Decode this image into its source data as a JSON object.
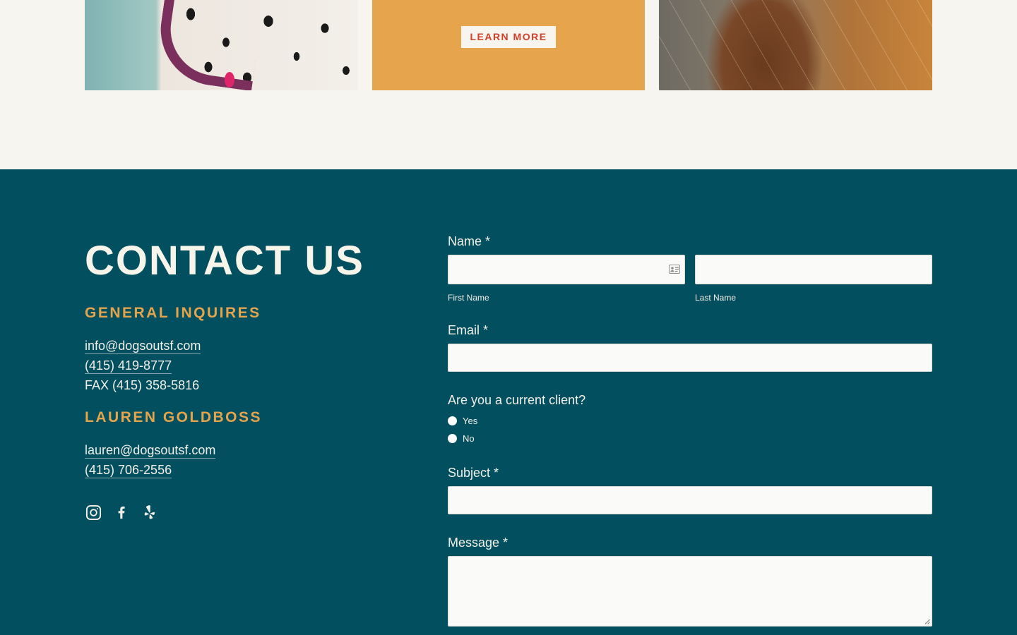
{
  "cards": {
    "learn_more": "LEARN MORE"
  },
  "contact": {
    "title": "CONTACT US",
    "general": {
      "heading": "GENERAL INQUIRES",
      "email": "info@dogsoutsf.com",
      "phone": "(415) 419-8777",
      "fax": "FAX  (415) 358-5816"
    },
    "lauren": {
      "heading": "LAUREN GOLDBOSS",
      "email": "lauren@dogsoutsf.com",
      "phone": "(415) 706-2556"
    },
    "social_icons": [
      "instagram-icon",
      "facebook-icon",
      "yelp-icon"
    ]
  },
  "form": {
    "name_label": "Name *",
    "first_name_label": "First Name",
    "last_name_label": "Last Name",
    "first_name_value": "",
    "last_name_value": "",
    "email_label": "Email *",
    "email_value": "",
    "client_question": "Are you a current client?",
    "client_options": [
      "Yes",
      "No"
    ],
    "subject_label": "Subject *",
    "subject_value": "",
    "message_label": "Message *",
    "message_value": ""
  },
  "colors": {
    "page_bg": "#f6f5f0",
    "contact_bg": "#02505f",
    "accent": "#e5a44b",
    "button_text": "#d43f2a"
  }
}
